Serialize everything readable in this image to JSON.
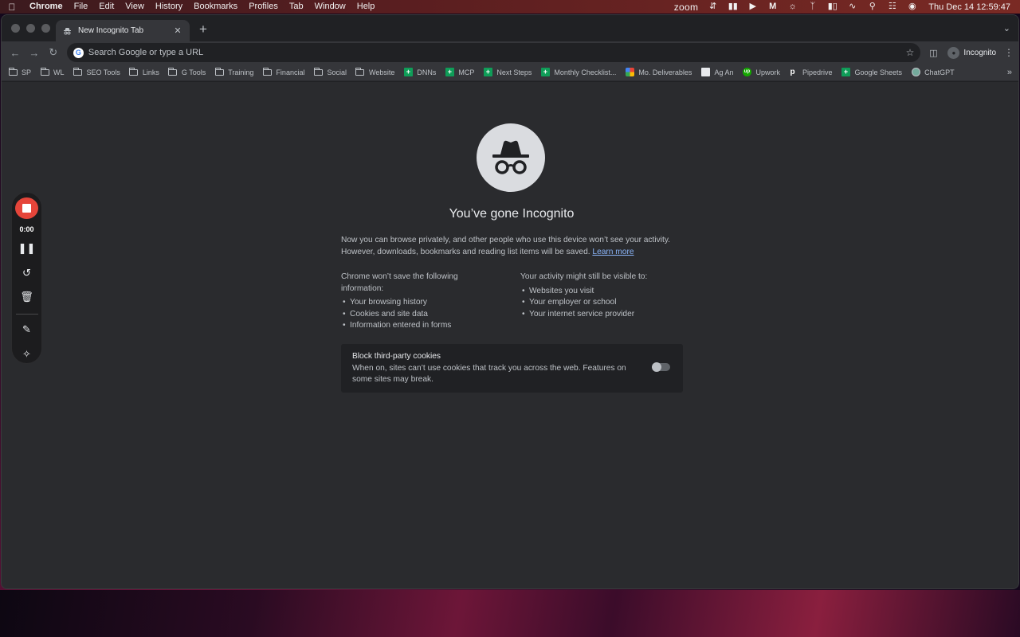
{
  "menubar": {
    "app_name": "Chrome",
    "menus": [
      "File",
      "Edit",
      "View",
      "History",
      "Bookmarks",
      "Profiles",
      "Tab",
      "Window",
      "Help"
    ],
    "zoom_label": "zoom",
    "clock": "Thu Dec 14  12:59:47"
  },
  "browser": {
    "tab_title": "New Incognito Tab",
    "omnibox_placeholder": "Search Google or type a URL",
    "profile_label": "Incognito"
  },
  "bookmarks": [
    {
      "label": "SP",
      "icon": "folder-icon"
    },
    {
      "label": "WL",
      "icon": "folder-icon"
    },
    {
      "label": "SEO Tools",
      "icon": "folder-icon"
    },
    {
      "label": "Links",
      "icon": "folder-icon"
    },
    {
      "label": "G Tools",
      "icon": "folder-icon"
    },
    {
      "label": "Training",
      "icon": "folder-icon"
    },
    {
      "label": "Financial",
      "icon": "folder-icon"
    },
    {
      "label": "Social",
      "icon": "folder-icon"
    },
    {
      "label": "Website",
      "icon": "folder-icon"
    },
    {
      "label": "DNNs",
      "icon": "sheets-icon"
    },
    {
      "label": "MCP",
      "icon": "sheets-icon"
    },
    {
      "label": "Next Steps",
      "icon": "sheets-icon"
    },
    {
      "label": "Monthly Checklist...",
      "icon": "sheets-icon"
    },
    {
      "label": "Mo. Deliverables",
      "icon": "pinwheel-icon"
    },
    {
      "label": "Ag An",
      "icon": "ag-icon"
    },
    {
      "label": "Upwork",
      "icon": "upwork-icon"
    },
    {
      "label": "Pipedrive",
      "icon": "pipedrive-icon"
    },
    {
      "label": "Google Sheets",
      "icon": "sheets-icon"
    },
    {
      "label": "ChatGPT",
      "icon": "chatgpt-icon"
    }
  ],
  "incognito_page": {
    "headline": "You’ve gone Incognito",
    "intro_line1": "Now you can browse privately, and other people who use this device won’t see your activity.",
    "intro_line2": "However, downloads, bookmarks and reading list items will be saved.",
    "learn_more": "Learn more",
    "left_heading": "Chrome won’t save the following information:",
    "left_items": [
      "Your browsing history",
      "Cookies and site data",
      "Information entered in forms"
    ],
    "right_heading": "Your activity might still be visible to:",
    "right_items": [
      "Websites you visit",
      "Your employer or school",
      "Your internet service provider"
    ],
    "cookie_title": "Block third-party cookies",
    "cookie_desc": "When on, sites can’t use cookies that track you across the web. Features on some sites may break.",
    "cookie_toggle_on": false
  },
  "recorder": {
    "elapsed": "0:00",
    "stop_color": "#e5453a"
  }
}
